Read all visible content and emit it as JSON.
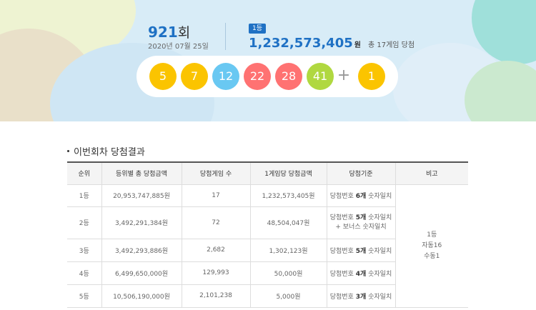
{
  "draw": {
    "round_number": "921",
    "round_suffix": "회",
    "date": "2020년 07월 25일"
  },
  "first_prize": {
    "badge": "1등",
    "amount": "1,232,573,405",
    "unit": "원",
    "note": "총 17게임 당첨"
  },
  "winning_numbers": [
    {
      "value": "5",
      "color": "#fbc400"
    },
    {
      "value": "7",
      "color": "#fbc400"
    },
    {
      "value": "12",
      "color": "#69c8f2"
    },
    {
      "value": "22",
      "color": "#ff7272"
    },
    {
      "value": "28",
      "color": "#ff7272"
    },
    {
      "value": "41",
      "color": "#b0d840"
    }
  ],
  "plus_symbol": "+",
  "bonus_number": {
    "value": "1",
    "color": "#fbc400"
  },
  "results_section": {
    "title": "이번회차 당첨결과",
    "columns": [
      "순위",
      "등위별 총 당첨금액",
      "당첨게임 수",
      "1게임당 당첨금액",
      "당첨기준",
      "비고"
    ],
    "rows": [
      {
        "rank": "1등",
        "total": "20,953,747,885원",
        "games": "17",
        "per_game": "1,232,573,405원",
        "criteria_pre": "당첨번호 ",
        "criteria_bold": "6개",
        "criteria_post": " 숫자일치",
        "criteria_line2": ""
      },
      {
        "rank": "2등",
        "total": "3,492,291,384원",
        "games": "72",
        "per_game": "48,504,047원",
        "criteria_pre": "당첨번호 ",
        "criteria_bold": "5개",
        "criteria_post": " 숫자일치",
        "criteria_line2": "+ 보너스 숫자일치"
      },
      {
        "rank": "3등",
        "total": "3,492,293,886원",
        "games": "2,682",
        "per_game": "1,302,123원",
        "criteria_pre": "당첨번호 ",
        "criteria_bold": "5개",
        "criteria_post": " 숫자일치",
        "criteria_line2": ""
      },
      {
        "rank": "4등",
        "total": "6,499,650,000원",
        "games": "129,993",
        "per_game": "50,000원",
        "criteria_pre": "당첨번호 ",
        "criteria_bold": "4개",
        "criteria_post": " 숫자일치",
        "criteria_line2": ""
      },
      {
        "rank": "5등",
        "total": "10,506,190,000원",
        "games": "2,101,238",
        "per_game": "5,000원",
        "criteria_pre": "당첨번호 ",
        "criteria_bold": "3개",
        "criteria_post": " 숫자일치",
        "criteria_line2": ""
      }
    ],
    "remarks": [
      "1등",
      "자동16",
      "수동1"
    ]
  }
}
